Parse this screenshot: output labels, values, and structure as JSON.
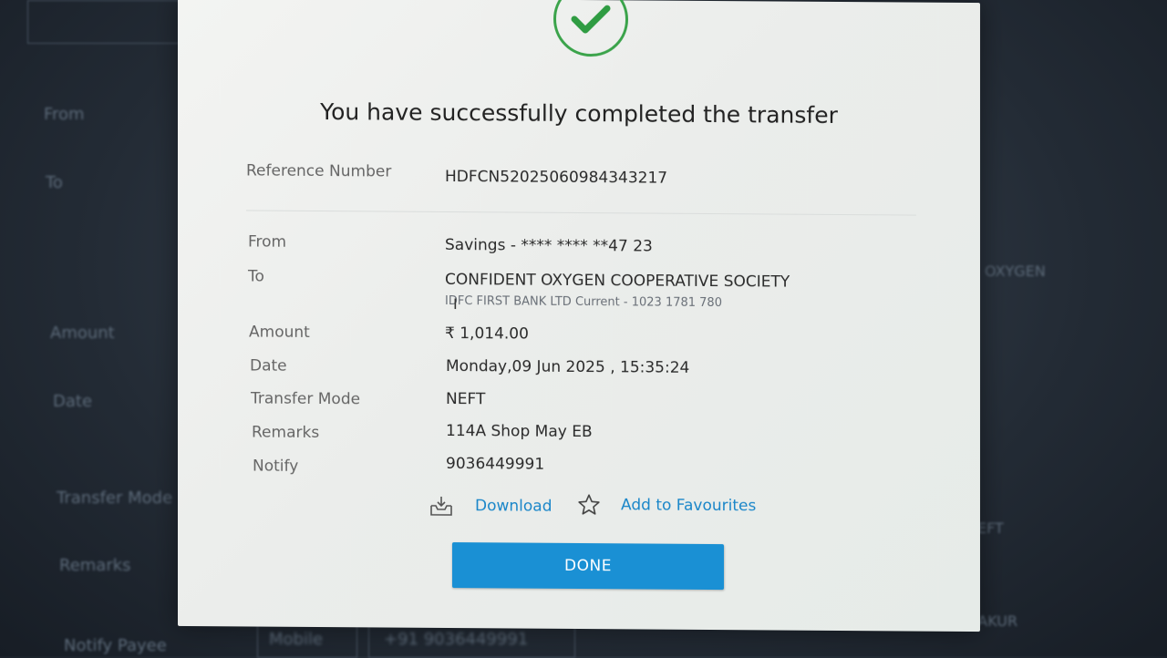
{
  "modal": {
    "title": "You have successfully completed the transfer",
    "reference": {
      "label": "Reference Number",
      "value": "HDFCN52025060984343217"
    },
    "from": {
      "label": "From",
      "value": "Savings - **** **** **47 23"
    },
    "to": {
      "label": "To",
      "value": "CONFIDENT OXYGEN COOPERATIVE SOCIETY",
      "sub": "IDFC FIRST BANK LTD Current - 1023 1781 780"
    },
    "amount": {
      "label": "Amount",
      "value": "₹ 1,014.00"
    },
    "date": {
      "label": "Date",
      "value": "Monday,09 Jun 2025 , 15:35:24"
    },
    "mode": {
      "label": "Transfer Mode",
      "value": "NEFT"
    },
    "remarks": {
      "label": "Remarks",
      "value": "114A Shop May EB"
    },
    "notify": {
      "label": "Notify",
      "value": "9036449991"
    },
    "download_label": "Download",
    "favourites_label": "Add to Favourites",
    "done_label": "DONE",
    "accent_color": "#1a90d4",
    "success_color": "#3aa34a"
  },
  "background": {
    "from_label": "From",
    "to_label": "To",
    "amount_label": "Amount",
    "date_label": "Date",
    "mode_label": "Transfer Mode",
    "remarks_label": "Remarks",
    "notify_label": "Notify Payee",
    "mobile_select": "Mobile",
    "mobile_value": "+91 9036449991",
    "name_text": "HIMANSHU THAKUR",
    "payee_text": "OXYGEN",
    "neft_text": "NEFT"
  }
}
